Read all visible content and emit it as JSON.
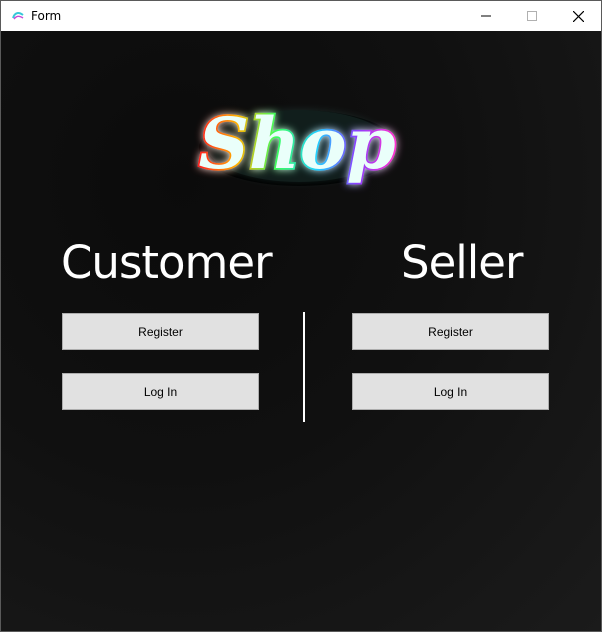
{
  "window": {
    "title": "Form",
    "icons": {
      "app": "shop-logo-icon",
      "minimize": "minimize-icon",
      "maximize": "maximize-icon",
      "close": "close-icon"
    }
  },
  "logo": {
    "text": "Shop",
    "colors": [
      "#ff2020",
      "#ffb400",
      "#38ff60",
      "#20d0ff",
      "#8a40ff",
      "#ff30d0"
    ]
  },
  "customer": {
    "title": "Customer",
    "register_label": "Register",
    "login_label": "Log In"
  },
  "seller": {
    "title": "Seller",
    "register_label": "Register",
    "login_label": "Log In"
  },
  "colors": {
    "background": "#111111",
    "button_bg": "#e1e1e1",
    "button_border": "#adadad",
    "text": "#ffffff"
  }
}
